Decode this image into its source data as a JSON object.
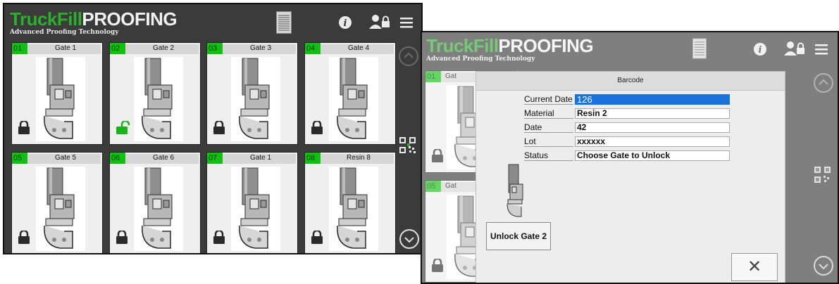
{
  "header": {
    "brand_green": "TruckFill",
    "brand_white": "PROOFING",
    "tagline": "Advanced Proofing Technology",
    "icons": [
      "document-icon",
      "info-icon",
      "user-lock-icon",
      "menu-icon"
    ]
  },
  "tiles": [
    {
      "num": "01",
      "name": "Gate 1",
      "locked": true
    },
    {
      "num": "02",
      "name": "Gate 2",
      "locked": false
    },
    {
      "num": "03",
      "name": "Gate 3",
      "locked": true
    },
    {
      "num": "04",
      "name": "Gate 4",
      "locked": true
    },
    {
      "num": "05",
      "name": "Gate 5",
      "locked": true
    },
    {
      "num": "06",
      "name": "Gate 6",
      "locked": true
    },
    {
      "num": "07",
      "name": "Gate 1",
      "locked": true
    },
    {
      "num": "08",
      "name": "Resin 8",
      "locked": true
    }
  ],
  "bg_tiles": [
    {
      "num": "01",
      "name": "Gat"
    },
    {
      "num": "05",
      "name": "Gat"
    }
  ],
  "dialog": {
    "title": "Barcode",
    "fields": [
      {
        "label": "Current Date",
        "value": "126"
      },
      {
        "label": "Material",
        "value": "Resin 2"
      },
      {
        "label": "Date",
        "value": "42"
      },
      {
        "label": "Lot",
        "value": "xxxxxx"
      },
      {
        "label": "Status",
        "value": "Choose Gate to Unlock"
      }
    ],
    "unlock_label": "Unlock Gate 2",
    "close_label": "✕"
  },
  "colors": {
    "background": "#3b3b3b",
    "brand_green": "#2bb02b",
    "tile_number": "#11c011",
    "unlocked": "#19b419",
    "selection": "#1a73d8"
  }
}
